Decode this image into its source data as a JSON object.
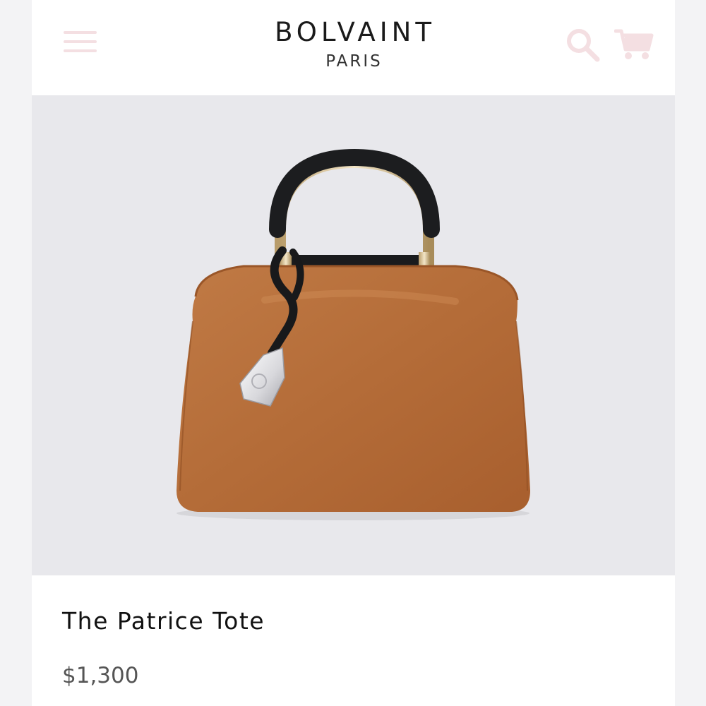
{
  "header": {
    "brand_name": "BOLVAINT",
    "brand_sub": "PARIS",
    "menu_icon": "hamburger-menu-icon",
    "search_icon": "search-icon",
    "cart_icon": "shopping-cart-icon",
    "icon_color": "#f4dfe2"
  },
  "product": {
    "title": "The Patrice Tote",
    "price": "$1,300",
    "image_background": "#e8e8ec",
    "bag_color": "#b8703f"
  }
}
